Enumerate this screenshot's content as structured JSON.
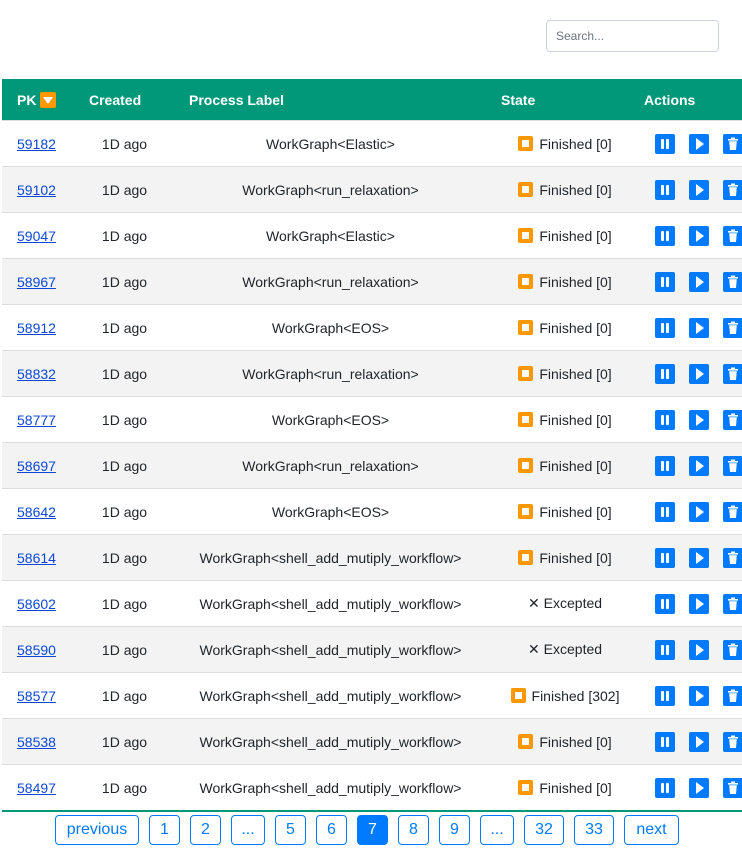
{
  "search": {
    "placeholder": "Search..."
  },
  "table": {
    "headers": {
      "pk": "PK",
      "created": "Created",
      "label": "Process Label",
      "state": "State",
      "actions": "Actions"
    },
    "rows": [
      {
        "pk": "59182",
        "created": "1D ago",
        "label": "WorkGraph<Elastic>",
        "state_icon": "finished-icon",
        "state": "Finished [0]"
      },
      {
        "pk": "59102",
        "created": "1D ago",
        "label": "WorkGraph<run_relaxation>",
        "state_icon": "finished-icon",
        "state": "Finished [0]"
      },
      {
        "pk": "59047",
        "created": "1D ago",
        "label": "WorkGraph<Elastic>",
        "state_icon": "finished-icon",
        "state": "Finished [0]"
      },
      {
        "pk": "58967",
        "created": "1D ago",
        "label": "WorkGraph<run_relaxation>",
        "state_icon": "finished-icon",
        "state": "Finished [0]"
      },
      {
        "pk": "58912",
        "created": "1D ago",
        "label": "WorkGraph<EOS>",
        "state_icon": "finished-icon",
        "state": "Finished [0]"
      },
      {
        "pk": "58832",
        "created": "1D ago",
        "label": "WorkGraph<run_relaxation>",
        "state_icon": "finished-icon",
        "state": "Finished [0]"
      },
      {
        "pk": "58777",
        "created": "1D ago",
        "label": "WorkGraph<EOS>",
        "state_icon": "finished-icon",
        "state": "Finished [0]"
      },
      {
        "pk": "58697",
        "created": "1D ago",
        "label": "WorkGraph<run_relaxation>",
        "state_icon": "finished-icon",
        "state": "Finished [0]"
      },
      {
        "pk": "58642",
        "created": "1D ago",
        "label": "WorkGraph<EOS>",
        "state_icon": "finished-icon",
        "state": "Finished [0]"
      },
      {
        "pk": "58614",
        "created": "1D ago",
        "label": "WorkGraph<shell_add_mutiply_workflow>",
        "state_icon": "finished-icon",
        "state": "Finished [0]"
      },
      {
        "pk": "58602",
        "created": "1D ago",
        "label": "WorkGraph<shell_add_mutiply_workflow>",
        "state_icon": "x-icon",
        "state": "Excepted"
      },
      {
        "pk": "58590",
        "created": "1D ago",
        "label": "WorkGraph<shell_add_mutiply_workflow>",
        "state_icon": "x-icon",
        "state": "Excepted"
      },
      {
        "pk": "58577",
        "created": "1D ago",
        "label": "WorkGraph<shell_add_mutiply_workflow>",
        "state_icon": "finished-icon",
        "state": "Finished [302]"
      },
      {
        "pk": "58538",
        "created": "1D ago",
        "label": "WorkGraph<shell_add_mutiply_workflow>",
        "state_icon": "finished-icon",
        "state": "Finished [0]"
      },
      {
        "pk": "58497",
        "created": "1D ago",
        "label": "WorkGraph<shell_add_mutiply_workflow>",
        "state_icon": "finished-icon",
        "state": "Finished [0]"
      }
    ],
    "action_icons": [
      "pause-icon",
      "play-icon",
      "trash-icon"
    ]
  },
  "pagination": {
    "previous": "previous",
    "pages": [
      "1",
      "2",
      "...",
      "5",
      "6",
      "7",
      "8",
      "9",
      "...",
      "32",
      "33"
    ],
    "active": "7",
    "next": "next"
  },
  "colors": {
    "header": "#009879",
    "accent": "#007bff",
    "state_finished": "#ff9800",
    "link": "#0d47d8"
  }
}
